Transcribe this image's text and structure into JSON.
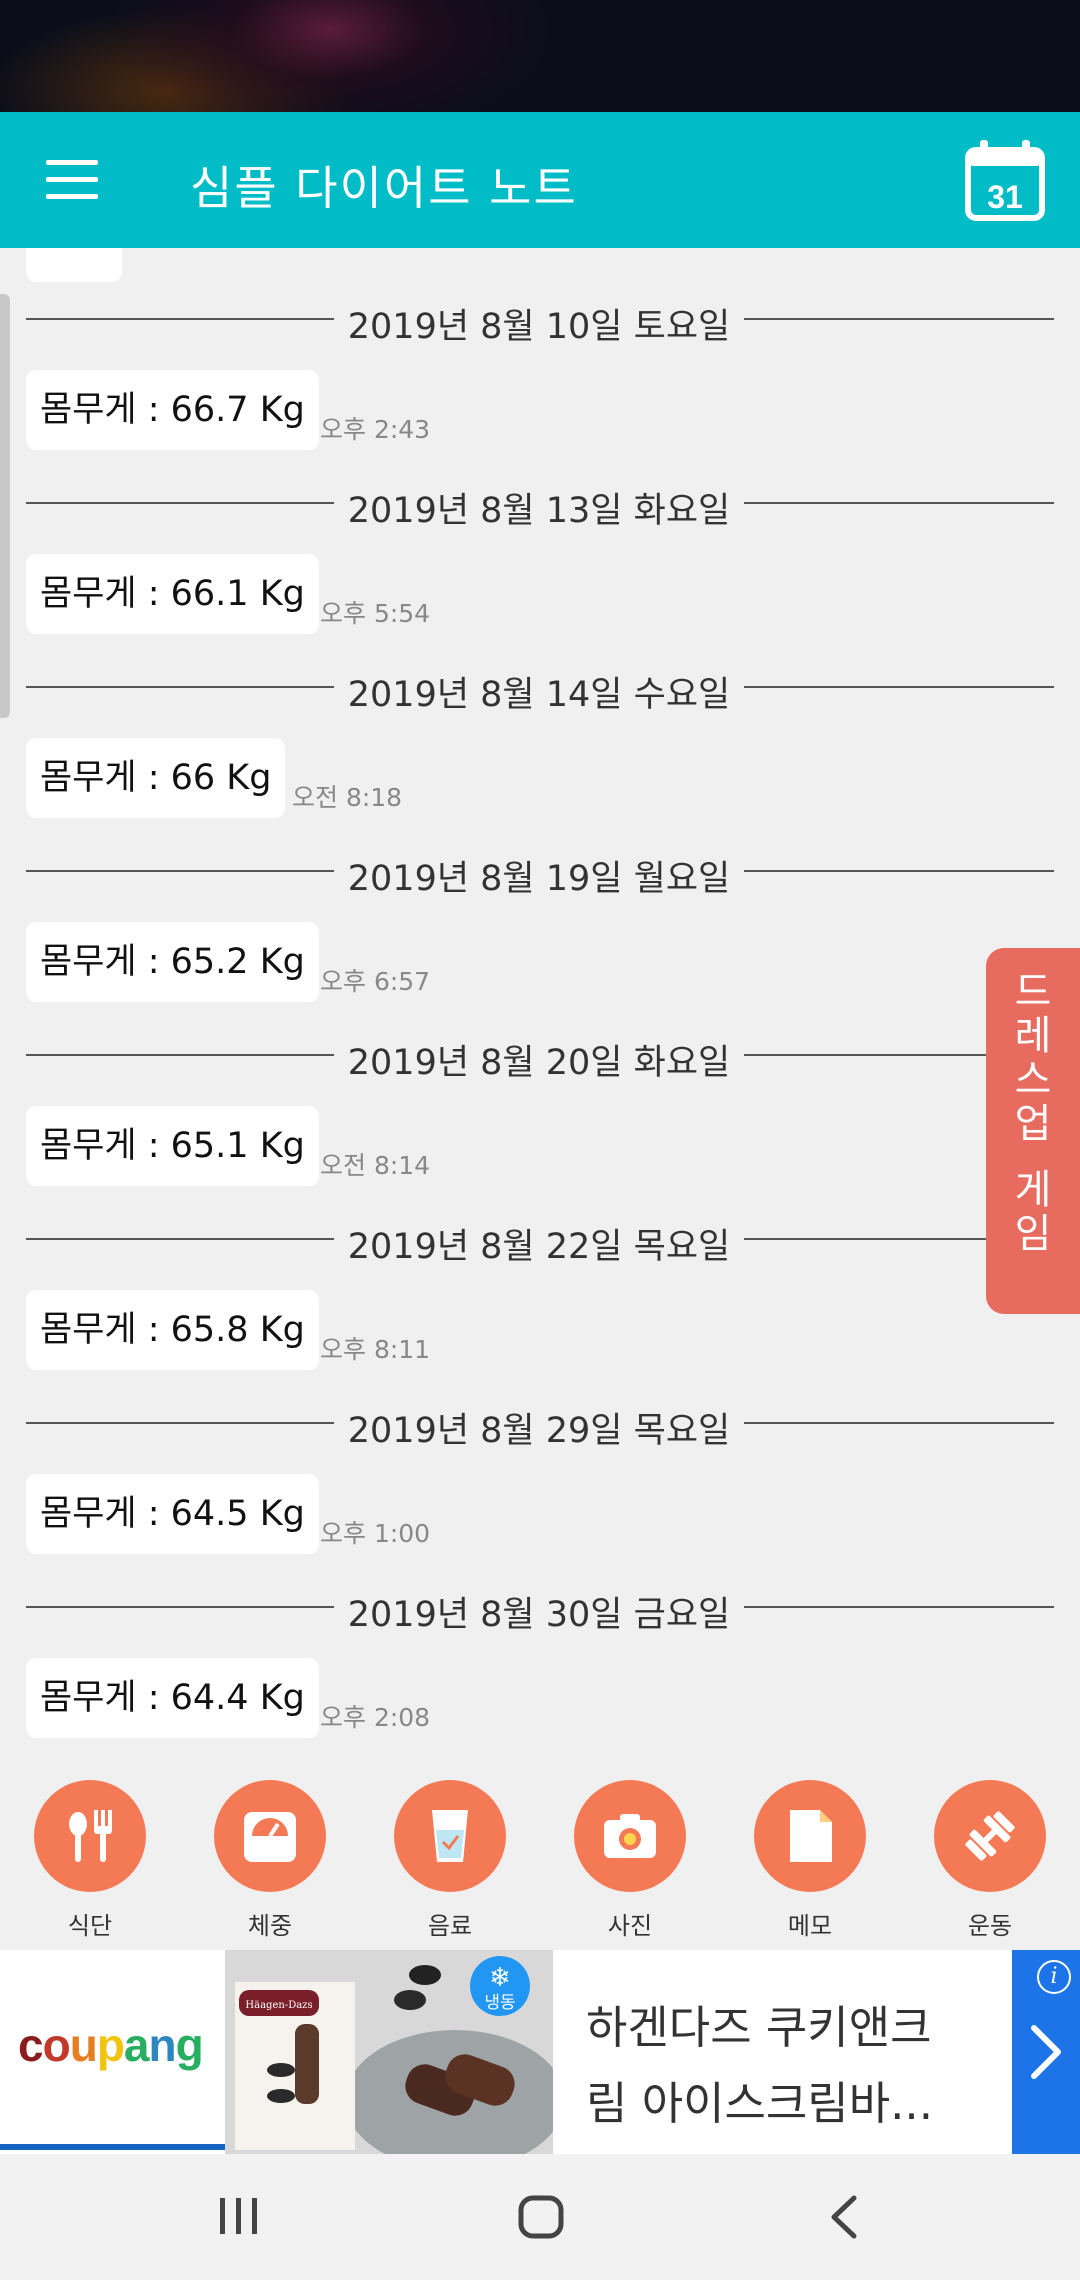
{
  "app": {
    "title": "심플 다이어트 노트",
    "calendar_day": "31"
  },
  "entries": [
    {
      "date": "2019년 8월 10일 토요일",
      "weight": "몸무게 : 66.7 Kg",
      "time": "오후 2:43"
    },
    {
      "date": "2019년 8월 13일 화요일",
      "weight": "몸무게 : 66.1 Kg",
      "time": "오후 5:54"
    },
    {
      "date": "2019년 8월 14일 수요일",
      "weight": "몸무게 : 66 Kg",
      "time": "오전 8:18"
    },
    {
      "date": "2019년 8월 19일 월요일",
      "weight": "몸무게 : 65.2 Kg",
      "time": "오후 6:57"
    },
    {
      "date": "2019년 8월 20일 화요일",
      "weight": "몸무게 : 65.1 Kg",
      "time": "오전 8:14"
    },
    {
      "date": "2019년 8월 22일 목요일",
      "weight": "몸무게 : 65.8 Kg",
      "time": "오후 8:11"
    },
    {
      "date": "2019년 8월 29일 목요일",
      "weight": "몸무게 : 64.5 Kg",
      "time": "오후 1:00"
    },
    {
      "date": "2019년 8월 30일 금요일",
      "weight": "몸무게 : 64.4 Kg",
      "time": "오후 2:08"
    }
  ],
  "side_banner": {
    "line1": "드레스업",
    "line2": "게임"
  },
  "nav": [
    {
      "label": "식단",
      "icon": "fork-spoon-icon"
    },
    {
      "label": "체중",
      "icon": "scale-icon"
    },
    {
      "label": "음료",
      "icon": "cup-icon"
    },
    {
      "label": "사진",
      "icon": "camera-icon"
    },
    {
      "label": "메모",
      "icon": "memo-icon"
    },
    {
      "label": "운동",
      "icon": "dumbbell-icon"
    }
  ],
  "ad": {
    "brand": "coupang",
    "badge": "냉동",
    "product_brand": "Häagen-Dazs",
    "text_line1": "하겐다즈 쿠키앤크",
    "text_line2": "림 아이스크림바...",
    "info": "i"
  },
  "colors": {
    "appbar": "#00bcc7",
    "nav_circle": "#f47a55",
    "side_banner": "#e86b5f",
    "ad_arrow": "#1d74e8"
  }
}
